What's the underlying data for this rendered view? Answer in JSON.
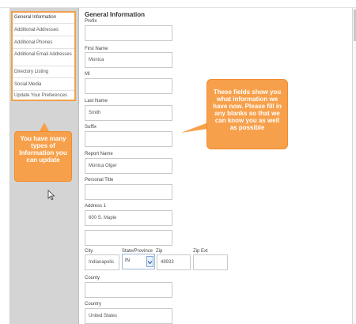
{
  "page_title": "General Information",
  "sidebar": {
    "items": [
      {
        "label": "General Information",
        "active": true
      },
      {
        "label": "Additional Addresses"
      },
      {
        "label": "Additional Phones"
      },
      {
        "label": "Additional Email Addresses"
      },
      {
        "label": "Directory Listing"
      },
      {
        "label": "Social Media"
      },
      {
        "label": "Update Your Preferences"
      }
    ]
  },
  "callouts": {
    "menu_note": "You have many types of Information you can update",
    "fields_note": "These fields show you what information we have now. Please fill in any blanks so that we can know you as well as possible",
    "color": "#f7a04b"
  },
  "form": {
    "prefix": {
      "label": "Prefix",
      "value": ""
    },
    "first_name": {
      "label": "First Name",
      "value": "Monica"
    },
    "mi": {
      "label": "MI",
      "value": ""
    },
    "last_name": {
      "label": "Last Name",
      "value": "Smith"
    },
    "suffix": {
      "label": "Suffix",
      "value": ""
    },
    "report_name": {
      "label": "Report Name",
      "value": "Monica Olger"
    },
    "personal_title": {
      "label": "Personal Title",
      "value": ""
    },
    "address1": {
      "label": "Address 1",
      "value": "600 S. Maple"
    },
    "address2": {
      "value": ""
    },
    "city": {
      "label": "City",
      "value": "Indianapolis"
    },
    "state": {
      "label": "State/Province",
      "value": "IN"
    },
    "zip": {
      "label": "Zip",
      "value": "48933"
    },
    "zip_ext": {
      "label": "Zip Ext",
      "value": ""
    },
    "county": {
      "label": "County",
      "value": ""
    },
    "country": {
      "label": "Country",
      "value": "United States"
    }
  }
}
